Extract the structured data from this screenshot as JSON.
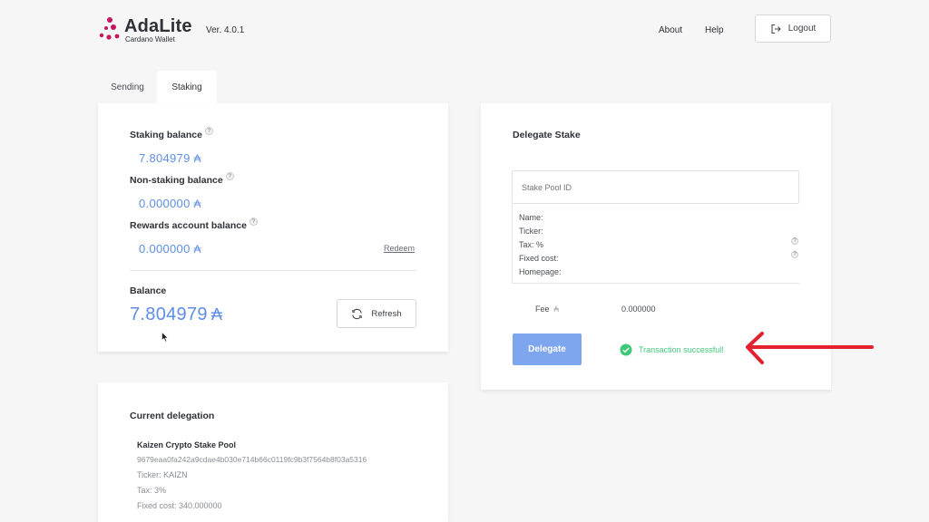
{
  "header": {
    "logo_title": "AdaLite",
    "logo_subtitle": "Cardano Wallet",
    "version": "Ver. 4.0.1",
    "nav": {
      "about": "About",
      "help": "Help",
      "logout": "Logout"
    }
  },
  "tabs": [
    {
      "label": "Sending",
      "active": false
    },
    {
      "label": "Staking",
      "active": true
    }
  ],
  "balances": {
    "staking_label": "Staking balance",
    "staking_value": "7.804979",
    "non_staking_label": "Non-staking balance",
    "non_staking_value": "0.000000",
    "rewards_label": "Rewards account balance",
    "rewards_value": "0.000000",
    "redeem_label": "Redeem",
    "balance_label": "Balance",
    "balance_value": "7.804979",
    "refresh_label": "Refresh",
    "currency_symbol": "₳",
    "help_glyph": "?"
  },
  "delegate": {
    "title": "Delegate Stake",
    "pool_id_placeholder": "Stake Pool ID",
    "fields": {
      "name": "Name:",
      "ticker": "Ticker:",
      "tax": "Tax: %",
      "fixed_cost": "Fixed cost:",
      "homepage": "Homepage:"
    },
    "fee_label": "Fee",
    "fee_value": "0.000000",
    "button_label": "Delegate",
    "status": "Transaction successful!"
  },
  "current_delegation": {
    "title": "Current delegation",
    "pool_name": "Kaizen Crypto Stake Pool",
    "pool_id": "9679eaa0fa242a9cdae4b030e714b66c0119fc9b3f7564b8f03a5316",
    "ticker": "Ticker: KAIZN",
    "tax": "Tax: 3%",
    "fixed_cost": "Fixed cost: 340.000000"
  },
  "colors": {
    "accent_blue": "#5d8ee4",
    "delegate_button": "#7ea6ee",
    "success_green": "#3ec97a",
    "annotation_red": "#e5202e",
    "logo_magenta": "#c7155f"
  },
  "icons": [
    "logo-dots-icon",
    "logout-icon",
    "help-icon",
    "refresh-icon",
    "check-circle-icon",
    "red-arrow-annotation",
    "cursor-pointer-icon"
  ]
}
